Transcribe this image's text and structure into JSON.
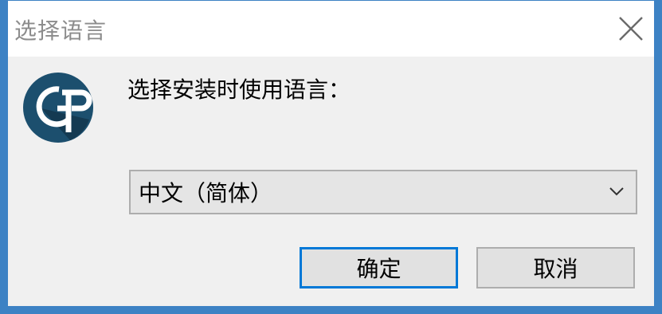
{
  "window": {
    "title": "选择语言"
  },
  "dialog": {
    "prompt": "选择安装时使用语言：",
    "language_select": {
      "selected": "中文（简体）"
    },
    "ok_label": "确定",
    "cancel_label": "取消"
  },
  "colors": {
    "accent": "#0078d7",
    "window_border": "#3d82c4",
    "logo_bg": "#1c4f6e"
  },
  "icons": {
    "close": "close-icon",
    "logo": "app-logo-icon",
    "dropdown": "chevron-down-icon"
  }
}
